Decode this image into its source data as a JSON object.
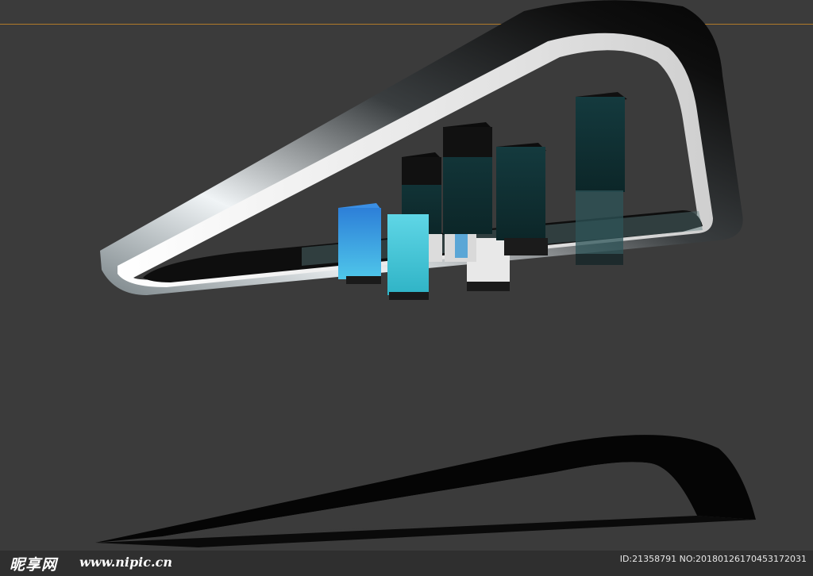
{
  "watermark": {
    "logo_text": "昵享网",
    "site_text": "www.nipic.cn",
    "image_id": "ID:21358791 NO:20180126170453172031"
  },
  "colors": {
    "background": "#3b3b3b",
    "frame_silver": "#d9dde0",
    "frame_dark": "#0b0b0b",
    "cube_cyan": "#3cc6d8",
    "cube_blue": "#3aa0e6",
    "cube_dark": "#103539",
    "cube_white": "#e6e6e6",
    "horizon_line": "#b07a2a"
  },
  "icons": [
    "triangular-frame",
    "glass-cube",
    "shadow-shape"
  ]
}
